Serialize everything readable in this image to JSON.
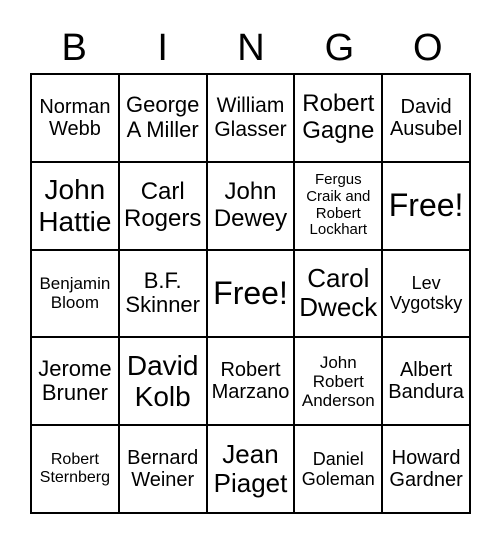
{
  "header": [
    "B",
    "I",
    "N",
    "G",
    "O"
  ],
  "cells": [
    "Norman Webb",
    "George A Miller",
    "William Glasser",
    "Robert Gagne",
    "David Ausubel",
    "John Hattie",
    "Carl Rogers",
    "John Dewey",
    "Fergus Craik and Robert Lockhart",
    "Free!",
    "Benjamin Bloom",
    "B.F. Skinner",
    "Free!",
    "Carol Dweck",
    "Lev Vygotsky",
    "Jerome Bruner",
    "David Kolb",
    "Robert Marzano",
    "John Robert Anderson",
    "Albert Bandura",
    "Robert Sternberg",
    "Bernard Weiner",
    "Jean Piaget",
    "Daniel Goleman",
    "Howard Gardner"
  ]
}
